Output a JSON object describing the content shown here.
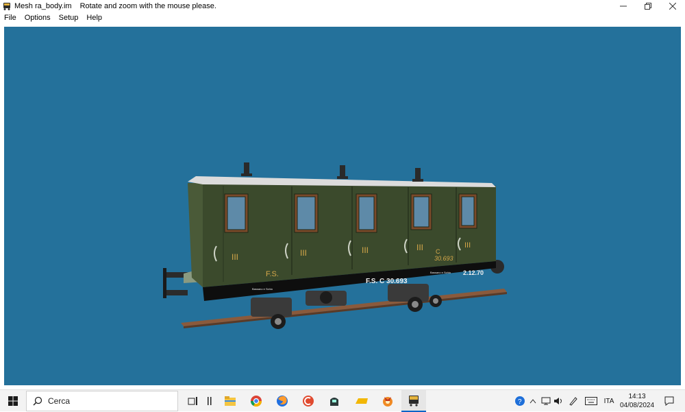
{
  "window": {
    "title": "Mesh ra_body.im",
    "hint": "Rotate and zoom with the mouse please.",
    "controls": [
      "minimize",
      "restore",
      "close"
    ]
  },
  "menu": [
    "File",
    "Options",
    "Setup",
    "Help"
  ],
  "viewport": {
    "background": "#24719b",
    "model": {
      "class_marks": [
        "III",
        "III",
        "III",
        "III",
        "III"
      ],
      "fs_left": "F.S.",
      "fs_number": "F.S. C 30.693",
      "side_c": "C",
      "side_number": "30.693",
      "end_number": "2.12.70",
      "small_label_1": "Bassano e Schio",
      "small_label_2": "Bassano e Schio",
      "body_color": "#3b4a2c",
      "roof_color": "#dcdcdc",
      "lettering_color": "#d6a84a"
    }
  },
  "taskbar": {
    "search_placeholder": "Cerca",
    "apps": [
      "task-view-icon",
      "widget-icon",
      "file-explorer-icon",
      "chrome-icon",
      "firefox-icon",
      "ccleaner-icon",
      "train-app-icon",
      "yellow-app-icon",
      "orange-app-icon",
      "mesh-viewer-icon"
    ],
    "tray": {
      "language": "ITA",
      "time": "14:13",
      "date": "04/08/2024"
    }
  }
}
